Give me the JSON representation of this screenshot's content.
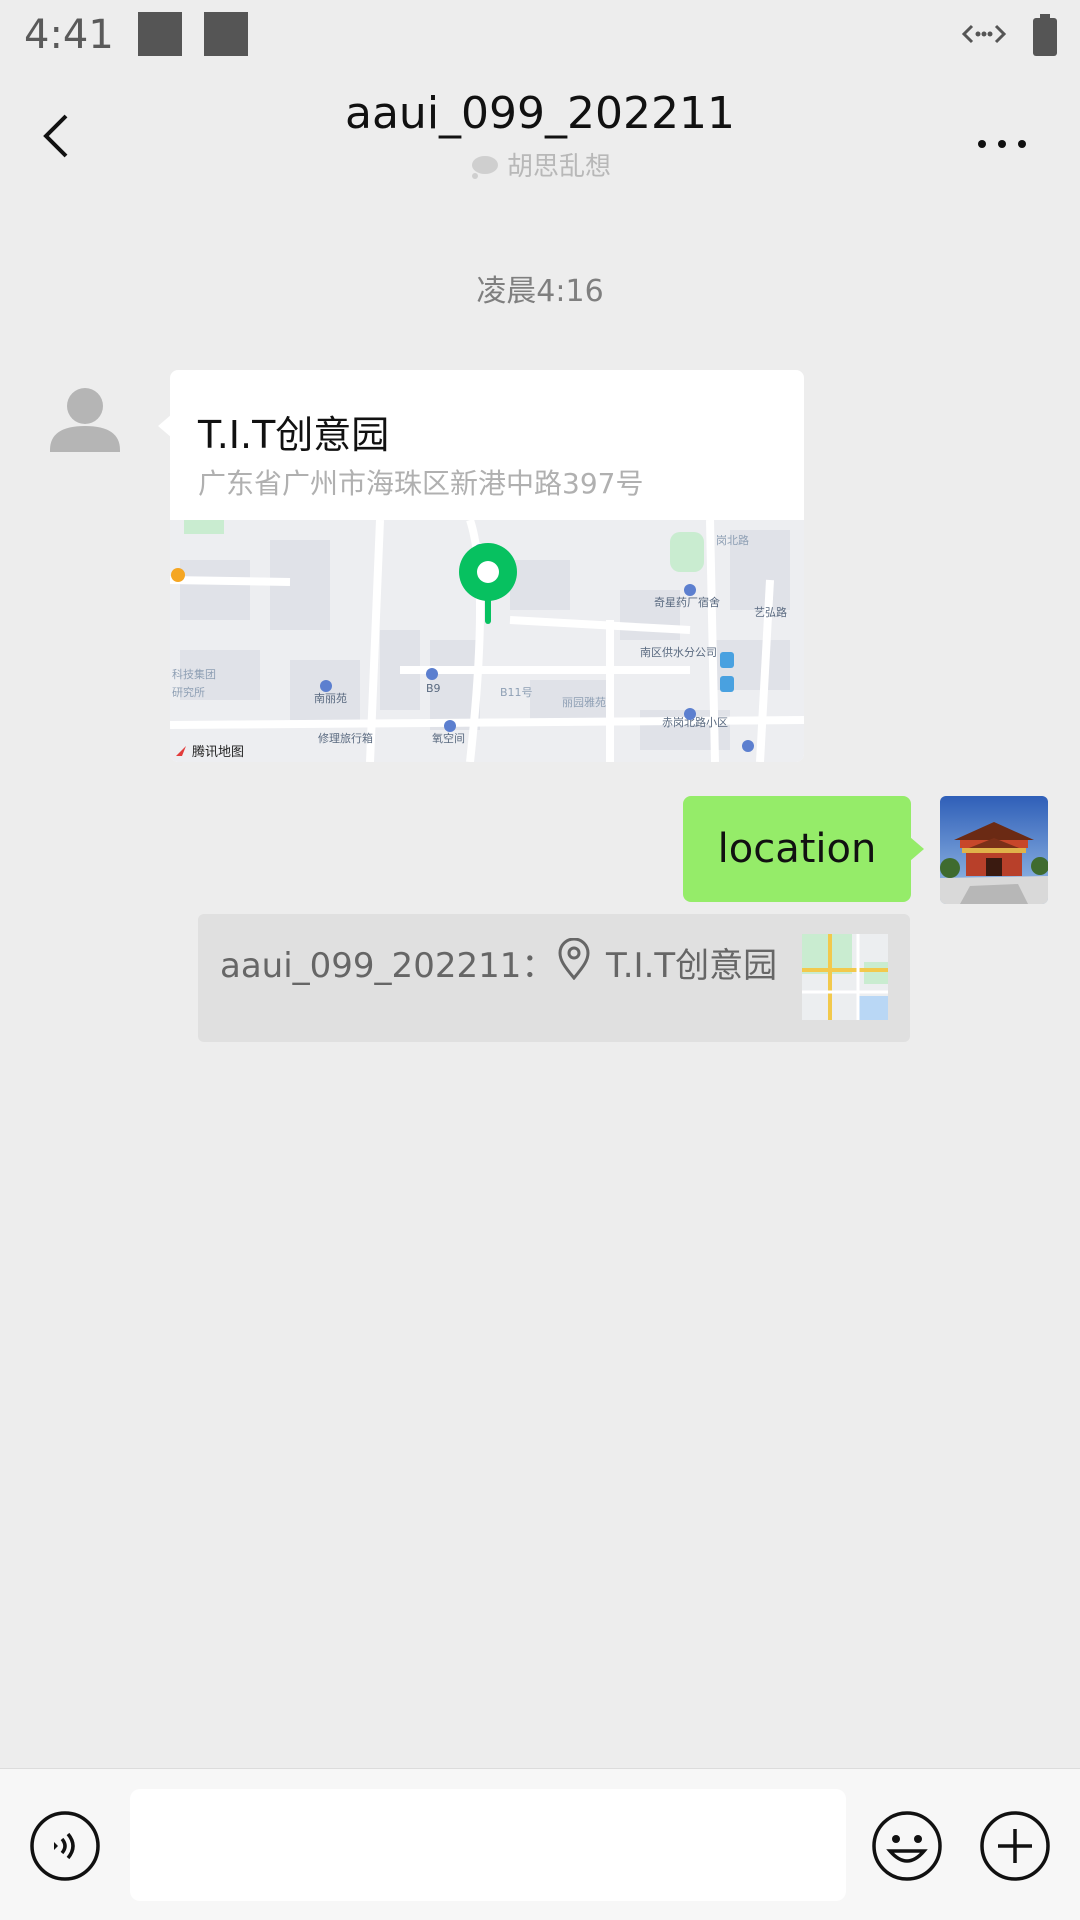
{
  "status_bar": {
    "time": "4:41"
  },
  "header": {
    "title": "aaui_099_202211",
    "subtitle": "胡思乱想"
  },
  "chat": {
    "timestamp": "凌晨4:16",
    "incoming_location": {
      "name": "T.I.T创意园",
      "address": "广东省广州市海珠区新港中路397号",
      "map_labels": {
        "brand": "腾讯地图",
        "poi_1": "奇星药厂宿舍",
        "poi_2": "南区供水分公司",
        "poi_3": "南丽苑",
        "poi_4": "B9",
        "poi_5": "修理旅行箱",
        "poi_6": "氧空间",
        "poi_7": "赤岗北路小区",
        "poi_8": "艺弘路",
        "poi_9": "科技集团",
        "poi_10": "研究所",
        "poi_11": "B11号",
        "poi_12": "丽园雅苑",
        "poi_13": "岗北路"
      }
    },
    "outgoing_message": {
      "text": "location"
    },
    "quote": {
      "sender": "aaui_099_202211：",
      "location_name": "T.I.T创意园"
    }
  },
  "input_bar": {
    "placeholder": ""
  },
  "colors": {
    "background": "#ededed",
    "outgoing_bubble": "#95ec69",
    "map_pin": "#07c160"
  }
}
